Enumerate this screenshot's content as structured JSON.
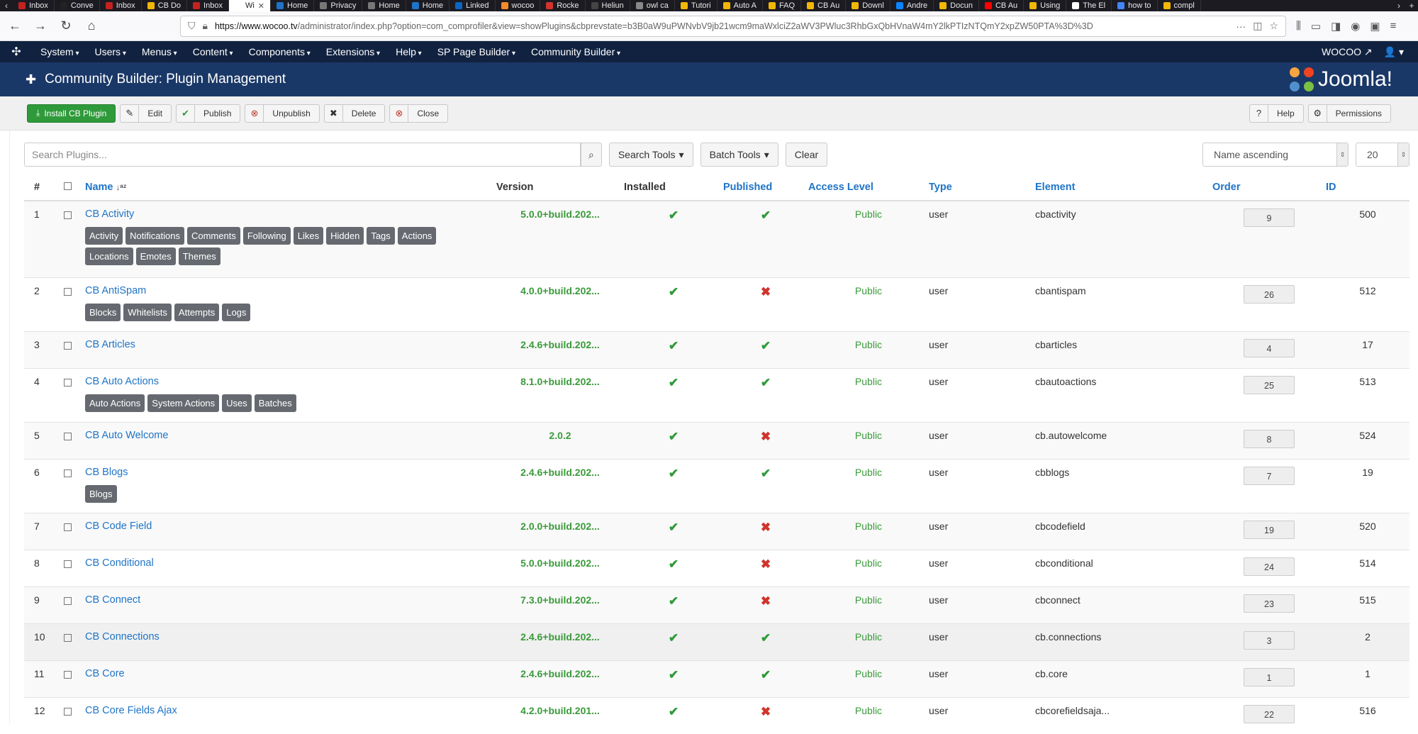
{
  "browser": {
    "tabs": [
      {
        "label": "Inbox",
        "color": "#c5221f"
      },
      {
        "label": "Conve",
        "color": "#222222"
      },
      {
        "label": "Inbox",
        "color": "#c5221f"
      },
      {
        "label": "CB Do",
        "color": "#f2b705"
      },
      {
        "label": "Inbox",
        "color": "#c5221f"
      },
      {
        "label": "Wi",
        "color": "#ffffff",
        "active": true
      },
      {
        "label": "Home",
        "color": "#1f74c7"
      },
      {
        "label": "Privacy",
        "color": "#777777"
      },
      {
        "label": "Home",
        "color": "#777777"
      },
      {
        "label": "Home",
        "color": "#1f74c7"
      },
      {
        "label": "Linked",
        "color": "#0a66c2"
      },
      {
        "label": "wocoo",
        "color": "#f28c28"
      },
      {
        "label": "Rocke",
        "color": "#d0342c"
      },
      {
        "label": "Heliun",
        "color": "#444444"
      },
      {
        "label": "owl ca",
        "color": "#888888"
      },
      {
        "label": "Tutori",
        "color": "#f2b705"
      },
      {
        "label": "Auto A",
        "color": "#f2b705"
      },
      {
        "label": "FAQ",
        "color": "#f2b705"
      },
      {
        "label": "CB Au",
        "color": "#f2b705"
      },
      {
        "label": "Downl",
        "color": "#f2b705"
      },
      {
        "label": "Andre",
        "color": "#0a84ff"
      },
      {
        "label": "Docun",
        "color": "#f2b705"
      },
      {
        "label": "CB Au",
        "color": "#ff0000"
      },
      {
        "label": "Using",
        "color": "#f2b705"
      },
      {
        "label": "The El",
        "color": "#ffffff"
      },
      {
        "label": "how to",
        "color": "#4285f4"
      },
      {
        "label": "compl",
        "color": "#f2b705"
      }
    ],
    "url_domain": "https://www.wocoo.tv",
    "url_path": "/administrator/index.php?option=com_comprofiler&view=showPlugins&cbprevstate=b3B0aW9uPWNvbV9jb21wcm9maWxlciZ2aWV3PWluc3RhbGxQbHVnaW4mY2lkPTIzNTQmY2xpZW50PTA%3D%3D"
  },
  "adminmenu": {
    "items": [
      "System",
      "Users",
      "Menus",
      "Content",
      "Components",
      "Extensions",
      "Help",
      "SP Page Builder",
      "Community Builder"
    ],
    "site_link": "WOCOO ↗",
    "user": "👤 ▾"
  },
  "header": {
    "title": "Community Builder: Plugin Management",
    "brand": "Joomla!"
  },
  "toolbar": {
    "install": "Install CB Plugin",
    "edit": "Edit",
    "publish": "Publish",
    "unpublish": "Unpublish",
    "delete": "Delete",
    "close": "Close",
    "help": "Help",
    "permissions": "Permissions"
  },
  "filters": {
    "search_placeholder": "Search Plugins...",
    "search_tools": "Search Tools",
    "batch_tools": "Batch Tools",
    "clear": "Clear",
    "sort": "Name ascending",
    "limit": "20"
  },
  "columns": {
    "num": "#",
    "name": "Name",
    "version": "Version",
    "installed": "Installed",
    "published": "Published",
    "access": "Access Level",
    "type": "Type",
    "element": "Element",
    "order": "Order",
    "id": "ID"
  },
  "rows": [
    {
      "num": "1",
      "name": "CB Activity",
      "tags": [
        "Activity",
        "Notifications",
        "Comments",
        "Following",
        "Likes",
        "Hidden",
        "Tags",
        "Actions",
        "Locations",
        "Emotes",
        "Themes"
      ],
      "version": "5.0.0+build.202...",
      "installed": true,
      "published": true,
      "access": "Public",
      "type": "user",
      "element": "cbactivity",
      "order": "9",
      "id": "500"
    },
    {
      "num": "2",
      "name": "CB AntiSpam",
      "tags": [
        "Blocks",
        "Whitelists",
        "Attempts",
        "Logs"
      ],
      "version": "4.0.0+build.202...",
      "installed": true,
      "published": false,
      "access": "Public",
      "type": "user",
      "element": "cbantispam",
      "order": "26",
      "id": "512"
    },
    {
      "num": "3",
      "name": "CB Articles",
      "tags": [],
      "version": "2.4.6+build.202...",
      "installed": true,
      "published": true,
      "access": "Public",
      "type": "user",
      "element": "cbarticles",
      "order": "4",
      "id": "17"
    },
    {
      "num": "4",
      "name": "CB Auto Actions",
      "tags": [
        "Auto Actions",
        "System Actions",
        "Uses",
        "Batches"
      ],
      "version": "8.1.0+build.202...",
      "installed": true,
      "published": true,
      "access": "Public",
      "type": "user",
      "element": "cbautoactions",
      "order": "25",
      "id": "513"
    },
    {
      "num": "5",
      "name": "CB Auto Welcome",
      "tags": [],
      "version": "2.0.2",
      "installed": true,
      "published": false,
      "access": "Public",
      "type": "user",
      "element": "cb.autowelcome",
      "order": "8",
      "id": "524"
    },
    {
      "num": "6",
      "name": "CB Blogs",
      "tags": [
        "Blogs"
      ],
      "version": "2.4.6+build.202...",
      "installed": true,
      "published": true,
      "access": "Public",
      "type": "user",
      "element": "cbblogs",
      "order": "7",
      "id": "19"
    },
    {
      "num": "7",
      "name": "CB Code Field",
      "tags": [],
      "version": "2.0.0+build.202...",
      "installed": true,
      "published": false,
      "access": "Public",
      "type": "user",
      "element": "cbcodefield",
      "order": "19",
      "id": "520"
    },
    {
      "num": "8",
      "name": "CB Conditional",
      "tags": [],
      "version": "5.0.0+build.202...",
      "installed": true,
      "published": false,
      "access": "Public",
      "type": "user",
      "element": "cbconditional",
      "order": "24",
      "id": "514"
    },
    {
      "num": "9",
      "name": "CB Connect",
      "tags": [],
      "version": "7.3.0+build.202...",
      "installed": true,
      "published": false,
      "access": "Public",
      "type": "user",
      "element": "cbconnect",
      "order": "23",
      "id": "515"
    },
    {
      "num": "10",
      "name": "CB Connections",
      "tags": [],
      "version": "2.4.6+build.202...",
      "installed": true,
      "published": true,
      "access": "Public",
      "type": "user",
      "element": "cb.connections",
      "order": "3",
      "id": "2",
      "highlight": true
    },
    {
      "num": "11",
      "name": "CB Core",
      "tags": [],
      "version": "2.4.6+build.202...",
      "installed": true,
      "published": true,
      "access": "Public",
      "type": "user",
      "element": "cb.core",
      "order": "1",
      "id": "1"
    },
    {
      "num": "12",
      "name": "CB Core Fields Ajax",
      "tags": [],
      "version": "4.2.0+build.201...",
      "installed": true,
      "published": false,
      "access": "Public",
      "type": "user",
      "element": "cbcorefieldsaja...",
      "order": "22",
      "id": "516"
    }
  ]
}
